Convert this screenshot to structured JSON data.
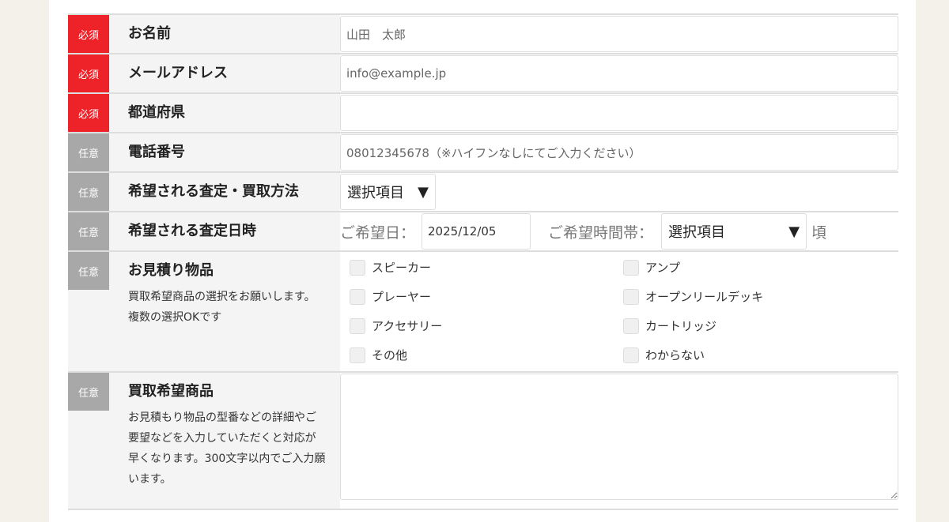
{
  "badges": {
    "required": "必須",
    "optional": "任意"
  },
  "fields": {
    "name": {
      "label": "お名前",
      "value": "山田　太郎"
    },
    "email": {
      "label": "メールアドレス",
      "value": "info@example.jp"
    },
    "pref": {
      "label": "都道府県",
      "value": ""
    },
    "tel": {
      "label": "電話番号",
      "placeholder": "08012345678（※ハイフンなしにてご入力ください）"
    },
    "method": {
      "label": "希望される査定・買取方法",
      "selected": "選択項目"
    },
    "datetime": {
      "label": "希望される査定日時",
      "date_label": "ご希望日：",
      "date_value": "2025/12/05",
      "time_label": "ご希望時間帯：",
      "time_selected": "選択項目",
      "suffix": "頃"
    },
    "items": {
      "label": "お見積り物品",
      "note": "買取希望商品の選択をお願いします。複数の選択OKです",
      "options": [
        "スピーカー",
        "アンプ",
        "プレーヤー",
        "オープンリールデッキ",
        "アクセサリー",
        "カートリッジ",
        "その他",
        "わからない"
      ]
    },
    "product": {
      "label": "買取希望商品",
      "note": "お見積もり物品の型番などの詳細やご要望などを入力していただくと対応が早くなります。300文字以内でご入力願います。"
    }
  },
  "arrow": "▼",
  "colors": {
    "required": "#ee2229",
    "optional": "#a8a8a8"
  }
}
